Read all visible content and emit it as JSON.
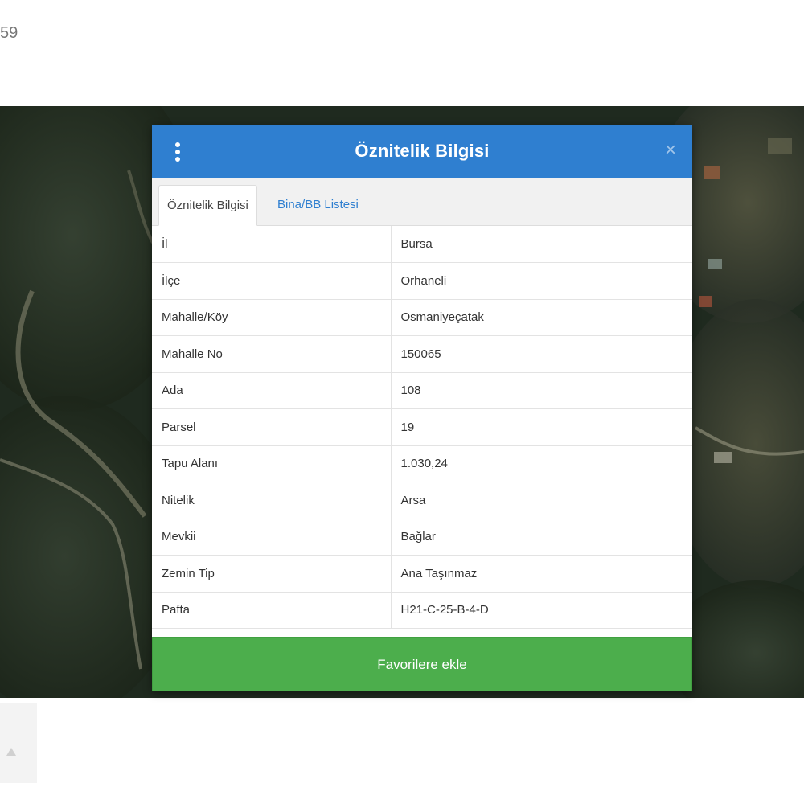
{
  "top_fragment": "59",
  "modal": {
    "title": "Öznitelik Bilgisi",
    "menu_icon": "kebab-vertical-icon",
    "close_icon": "close-icon",
    "close_glyph": "×"
  },
  "tabs": [
    {
      "label": "Öznitelik Bilgisi",
      "active": true
    },
    {
      "label": "Bina/BB Listesi",
      "active": false
    }
  ],
  "attributes": [
    {
      "key": "İl",
      "value": "Bursa"
    },
    {
      "key": "İlçe",
      "value": "Orhaneli"
    },
    {
      "key": "Mahalle/Köy",
      "value": "Osmaniyeçatak"
    },
    {
      "key": "Mahalle No",
      "value": "150065"
    },
    {
      "key": "Ada",
      "value": "108"
    },
    {
      "key": "Parsel",
      "value": "19"
    },
    {
      "key": "Tapu Alanı",
      "value": "1.030,24"
    },
    {
      "key": "Nitelik",
      "value": "Arsa"
    },
    {
      "key": "Mevkii",
      "value": "Bağlar"
    },
    {
      "key": "Zemin Tip",
      "value": "Ana Taşınmaz"
    },
    {
      "key": "Pafta",
      "value": "H21-C-25-B-4-D"
    }
  ],
  "favorites_button": "Favorilere ekle",
  "colors": {
    "header_blue": "#2f7fd0",
    "button_green": "#4cae4c",
    "tab_link_blue": "#2f7fd0"
  }
}
